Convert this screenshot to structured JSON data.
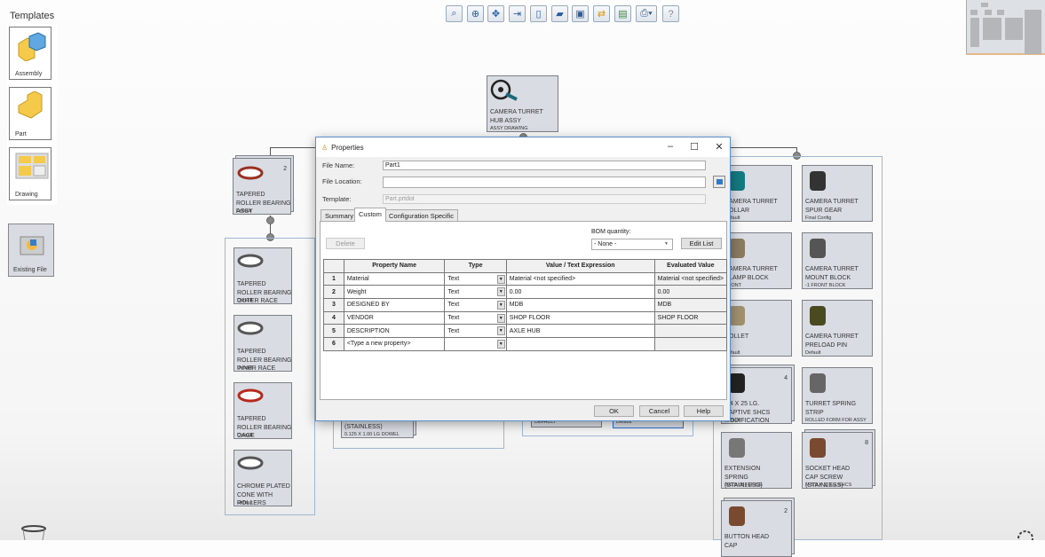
{
  "templates": {
    "title": "Templates",
    "items": [
      {
        "label": "Assembly",
        "icon": "assembly-icon"
      },
      {
        "label": "Part",
        "icon": "part-icon"
      },
      {
        "label": "Drawing",
        "icon": "drawing-icon"
      }
    ],
    "existing_label": "Existing File"
  },
  "toolbar": {
    "buttons": [
      "zoom-fit",
      "zoom-area",
      "zoom-pan",
      "insert",
      "new-document",
      "open-folder",
      "save",
      "reorganize",
      "export",
      "print",
      "help"
    ]
  },
  "tree": {
    "root": {
      "title": "CAMERA TURRET HUB ASSY",
      "sub": "ASSY DRAWING"
    },
    "left_top": {
      "title": "TAPERED ROLLER BEARING ASSY",
      "sub": "Default",
      "count": "2"
    },
    "left_children": [
      {
        "title": "TAPERED ROLLER BEARING OUTER RACE",
        "sub": "Default"
      },
      {
        "title": "TAPERED ROLLER BEARING INNER RACE",
        "sub": "Default"
      },
      {
        "title": "TAPERED ROLLER BEARING CAGE",
        "sub": "Default"
      },
      {
        "title": "CHROME PLATED CONE WITH ROLLERS",
        "sub": "Default"
      }
    ],
    "middle": [
      {
        "title": "(STAINLESS)",
        "sub": "0.125 X 1.00 LG DOWEL"
      },
      {
        "sub": "DEFAULT"
      },
      {
        "sub": "Default"
      }
    ],
    "right": [
      {
        "title": "CAMERA TURRET COLLAR",
        "sub": "Default"
      },
      {
        "title": "CAMERA TURRET SPUR GEAR",
        "sub": "Final Config"
      },
      {
        "title": "CAMERA TURRET CLAMP BLOCK",
        "sub": "FRONT"
      },
      {
        "title": "CAMERA TURRET MOUNT BLOCK",
        "sub": "-1 FRONT BLOCK"
      },
      {
        "title": "COLLET",
        "sub": "Default"
      },
      {
        "title": "CAMERA TURRET PRELOAD PIN",
        "sub": "Default"
      },
      {
        "title": "M4 X 25 LG. CAPTIVE SHCS MODIFICATION",
        "sub": "Default",
        "count": "4"
      },
      {
        "title": "TURRET SPRING STRIP",
        "sub": "ROLLED FORM FOR ASSY"
      },
      {
        "title": "EXTENSION SPRING (STAINLESS)",
        "sub": "300.0 LB FORCE"
      },
      {
        "title": "SOCKET HEAD CAP SCREW (STAINLESS)",
        "sub": "M 5.0 X 12 LG SHCS",
        "count": "8"
      },
      {
        "title": "BUTTON HEAD CAP",
        "sub": "",
        "count": "2"
      }
    ]
  },
  "dialog": {
    "title": "Properties",
    "file_name_label": "File Name:",
    "file_name": "Part1",
    "file_location_label": "File Location:",
    "file_location": "",
    "template_label": "Template:",
    "template": "Part.prtdot",
    "tabs": [
      "Summary",
      "Custom",
      "Configuration Specific"
    ],
    "active_tab": "Custom",
    "delete_label": "Delete",
    "bom_label": "BOM quantity:",
    "bom_value": "- None -",
    "edit_list_label": "Edit List",
    "columns": [
      "",
      "Property Name",
      "Type",
      "Value / Text Expression",
      "Evaluated Value"
    ],
    "rows": [
      {
        "n": "1",
        "name": "Material",
        "type": "Text",
        "value": "Material <not specified>",
        "eval": "Material <not specified>"
      },
      {
        "n": "2",
        "name": "Weight",
        "type": "Text",
        "value": "0.00",
        "eval": "0.00"
      },
      {
        "n": "3",
        "name": "DESIGNED BY",
        "type": "Text",
        "value": "MDB",
        "eval": "MDB"
      },
      {
        "n": "4",
        "name": "VENDOR",
        "type": "Text",
        "value": "SHOP FLOOR",
        "eval": "SHOP FLOOR"
      },
      {
        "n": "5",
        "name": "DESCRIPTION",
        "type": "Text",
        "value": "AXLE HUB",
        "eval": ""
      },
      {
        "n": "6",
        "name": "<Type a new property>",
        "type": "",
        "value": "",
        "eval": ""
      }
    ],
    "ok_label": "OK",
    "cancel_label": "Cancel",
    "help_label": "Help"
  }
}
